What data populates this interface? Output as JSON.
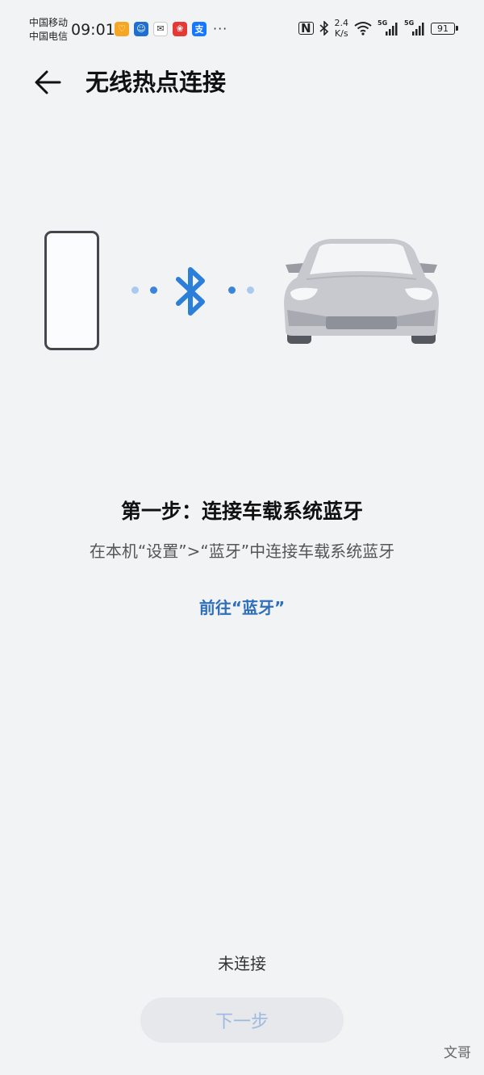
{
  "status_bar": {
    "carrier_1": "中国移动",
    "carrier_2": "中国电信",
    "time": "09:01",
    "app_icons": [
      {
        "name": "app-icon-orange",
        "color": "#f5a623",
        "glyph": "♡"
      },
      {
        "name": "app-icon-blue",
        "color": "#1f6fd1",
        "glyph": "☺"
      },
      {
        "name": "wechat-icon",
        "color": "#ffffff",
        "glyph": "✉"
      },
      {
        "name": "app-icon-red",
        "color": "#e53935",
        "glyph": "❀"
      },
      {
        "name": "alipay-icon",
        "color": "#1677ff",
        "glyph": "支"
      }
    ],
    "more": "···",
    "network_speed_value": "2.4",
    "network_speed_unit": "K/s",
    "signal_label_1": "5G",
    "signal_label_2": "5G",
    "battery": "91"
  },
  "header": {
    "title": "无线热点连接"
  },
  "illustration": {
    "bluetooth_color": "#2b7fd8",
    "dot_colors": [
      "#a9c9ee",
      "#3a84dc"
    ]
  },
  "content": {
    "step_title": "第一步：连接车载系统蓝牙",
    "step_desc": "在本机“设置”>“蓝牙”中连接车载系统蓝牙",
    "goto_link": "前往“蓝牙”"
  },
  "footer": {
    "status": "未连接",
    "next_button": "下一步"
  },
  "watermark": "文哥"
}
